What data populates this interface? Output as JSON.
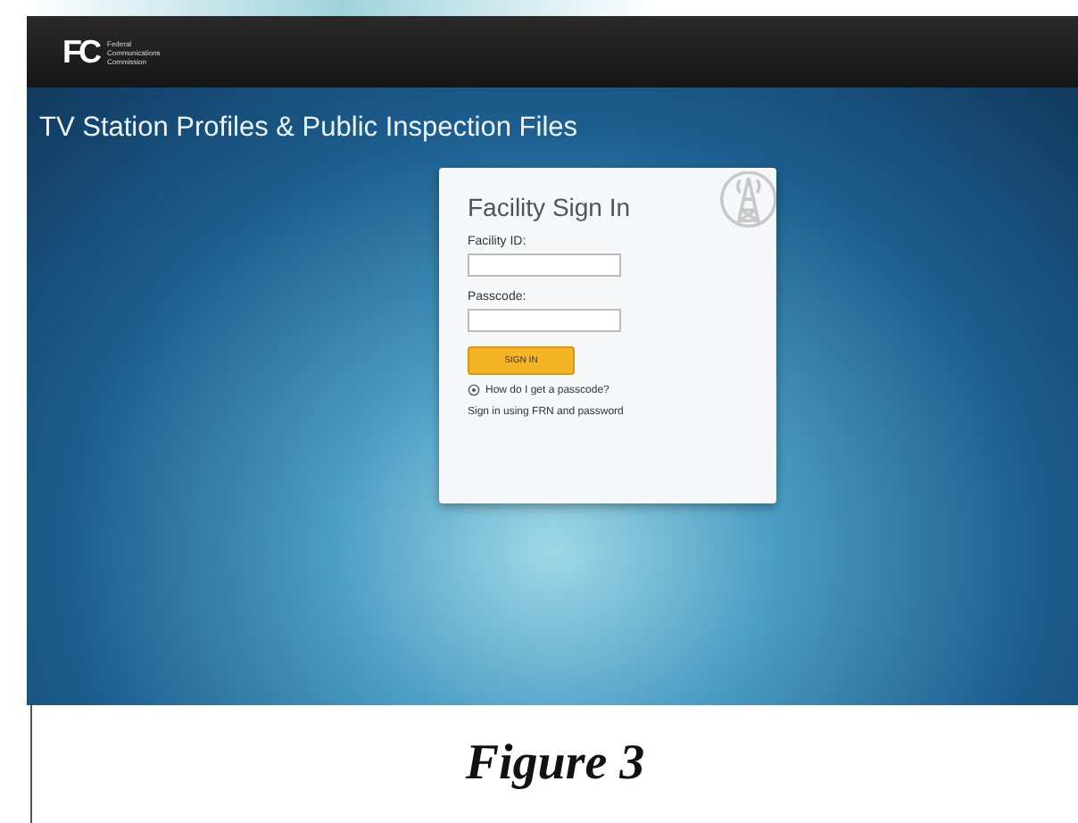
{
  "header": {
    "logo_mark": "FC",
    "agency_name": [
      "Federal",
      "Communications",
      "Commission"
    ]
  },
  "page_title": "TV Station Profiles & Public Inspection Files",
  "sign_in": {
    "title": "Facility Sign In",
    "fields": [
      {
        "label": "Facility ID:"
      },
      {
        "label": "Passcode:"
      }
    ],
    "button": "SIGN IN",
    "help_link": "How do I get a passcode?",
    "alt_link": "Sign in using FRN and password"
  },
  "caption": "Figure 3"
}
